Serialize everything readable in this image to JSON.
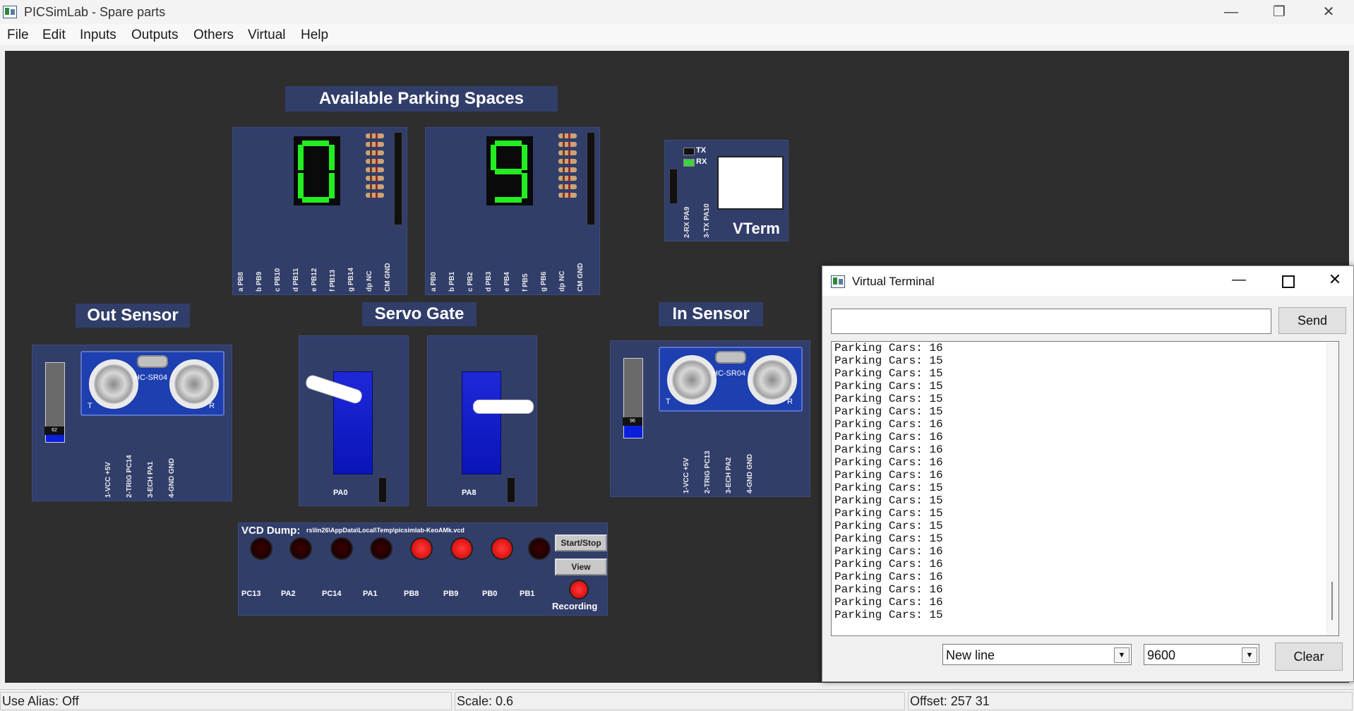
{
  "window": {
    "title": "PICSimLab - Spare parts",
    "minimize": "—",
    "maximize": "❐",
    "close": "✕"
  },
  "menu": [
    "File",
    "Edit",
    "Inputs",
    "Outputs",
    "Others",
    "Virtual",
    "Help"
  ],
  "parts": {
    "parking_title": "Available Parking Spaces",
    "display_left": {
      "digit": "0",
      "pins": [
        "a PB8",
        "b PB9",
        "c PB10",
        "d PB11",
        "e PB12",
        "f PB13",
        "g PB14",
        "dp NC",
        "CM GND"
      ]
    },
    "display_right": {
      "digit": "9",
      "pins": [
        "a PB0",
        "b PB1",
        "c PB2",
        "d PB3",
        "e PB4",
        "f PB5",
        "g PB6",
        "dp NC",
        "CM GND"
      ]
    },
    "vterm_part": {
      "tx": "TX",
      "rx": "RX",
      "label": "VTerm",
      "pin1": "2-RX PA9",
      "pin2": "3-TX PA10"
    },
    "out_sensor": {
      "title": "Out Sensor",
      "chip": "HC-SR04",
      "t": "T",
      "r": "R",
      "slider_value": "62",
      "pins": [
        "1-VCC +5V",
        "2-TRIG PC14",
        "3-ECH PA1",
        "4-GND GND"
      ]
    },
    "in_sensor": {
      "title": "In Sensor",
      "chip": "HC-SR04",
      "t": "T",
      "r": "R",
      "slider_value": "96",
      "pins": [
        "1-VCC +5V",
        "2-TRIG PC13",
        "3-ECH PA2",
        "4-GND GND"
      ]
    },
    "servo_gate": {
      "title": "Servo Gate",
      "servo1_pin": "PA0",
      "servo2_pin": "PA8"
    },
    "vcd": {
      "title": "VCD Dump:",
      "path": "rs\\lin26\\AppData\\Local\\Temp\\picsimlab-KeoAMk.vcd",
      "start_stop": "Start/Stop",
      "view": "View",
      "recording": "Recording",
      "channels": [
        "PC13",
        "PA2",
        "PC14",
        "PA1",
        "PB8",
        "PB9",
        "PB0",
        "PB1"
      ],
      "led_states": [
        0,
        0,
        0,
        0,
        1,
        1,
        1,
        0
      ]
    }
  },
  "terminal": {
    "title": "Virtual Terminal",
    "input_value": "",
    "send_label": "Send",
    "lines": [
      "Parking Cars: 16",
      "Parking Cars: 15",
      "Parking Cars: 15",
      "Parking Cars: 15",
      "Parking Cars: 15",
      "Parking Cars: 15",
      "Parking Cars: 16",
      "Parking Cars: 16",
      "Parking Cars: 16",
      "Parking Cars: 16",
      "Parking Cars: 16",
      "Parking Cars: 15",
      "Parking Cars: 15",
      "Parking Cars: 15",
      "Parking Cars: 15",
      "Parking Cars: 15",
      "Parking Cars: 16",
      "Parking Cars: 16",
      "Parking Cars: 16",
      "Parking Cars: 16",
      "Parking Cars: 16",
      "Parking Cars: 15"
    ],
    "line_ending": "New line",
    "baud": "9600",
    "clear_label": "Clear"
  },
  "status": {
    "alias": "Use Alias: Off",
    "scale": "Scale: 0.6",
    "offset": "Offset: 257  31"
  }
}
